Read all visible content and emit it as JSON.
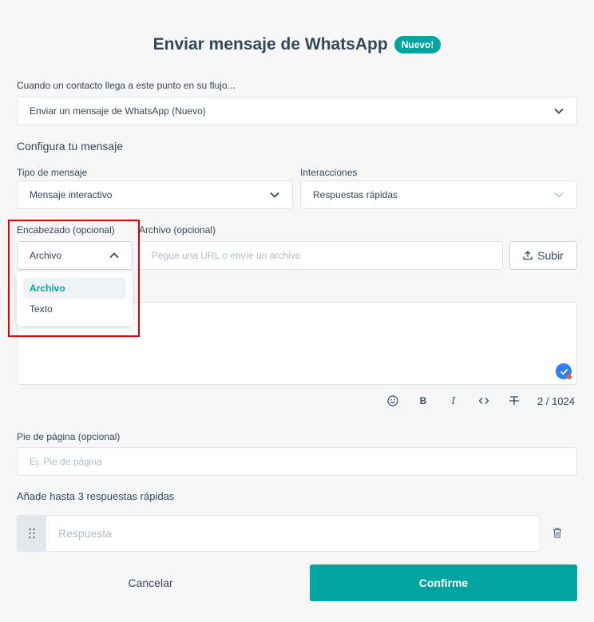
{
  "header": {
    "title": "Enviar mensaje de WhatsApp",
    "badge": "Nuevo!"
  },
  "trigger": {
    "label": "Cuando un contacto llega a este punto en su flujo...",
    "value": "Enviar un mensaje de WhatsApp (Nuevo)"
  },
  "configure": {
    "section_title": "Configura tu mensaje",
    "message_type": {
      "label": "Tipo de mensaje",
      "value": "Mensaje interactivo"
    },
    "interactions": {
      "label": "Interacciones",
      "value": "Respuestas rápidas"
    },
    "header_field": {
      "label": "Encabezado (opcional)",
      "value": "Archivo",
      "options": [
        "Archivo",
        "Texto"
      ],
      "selected_index": 0
    },
    "file": {
      "label": "Archivo (opcional)",
      "placeholder": "Pegue una URL o envíe un archivo",
      "upload_label": "Subir"
    },
    "body": {
      "counter": "2 / 1024",
      "toolbar": {
        "bold": "B",
        "italic": "I"
      }
    },
    "footer": {
      "label": "Pie de página (opcional)",
      "placeholder": "Ej: Pie de página"
    },
    "quick_replies": {
      "title": "Añade hasta 3 respuestas rápidas",
      "placeholder": "Respuesta"
    }
  },
  "actions": {
    "cancel": "Cancelar",
    "confirm": "Confirme"
  },
  "colors": {
    "accent": "#00a4a0",
    "highlight": "#e00000",
    "check": "#2f80ed",
    "dot": "#ff5c35"
  },
  "icons": [
    "chevron-down-icon",
    "chevron-up-icon",
    "upload-icon",
    "emoji-icon",
    "code-icon",
    "strikethrough-icon",
    "drag-handle-icon",
    "trash-icon",
    "check-icon"
  ]
}
